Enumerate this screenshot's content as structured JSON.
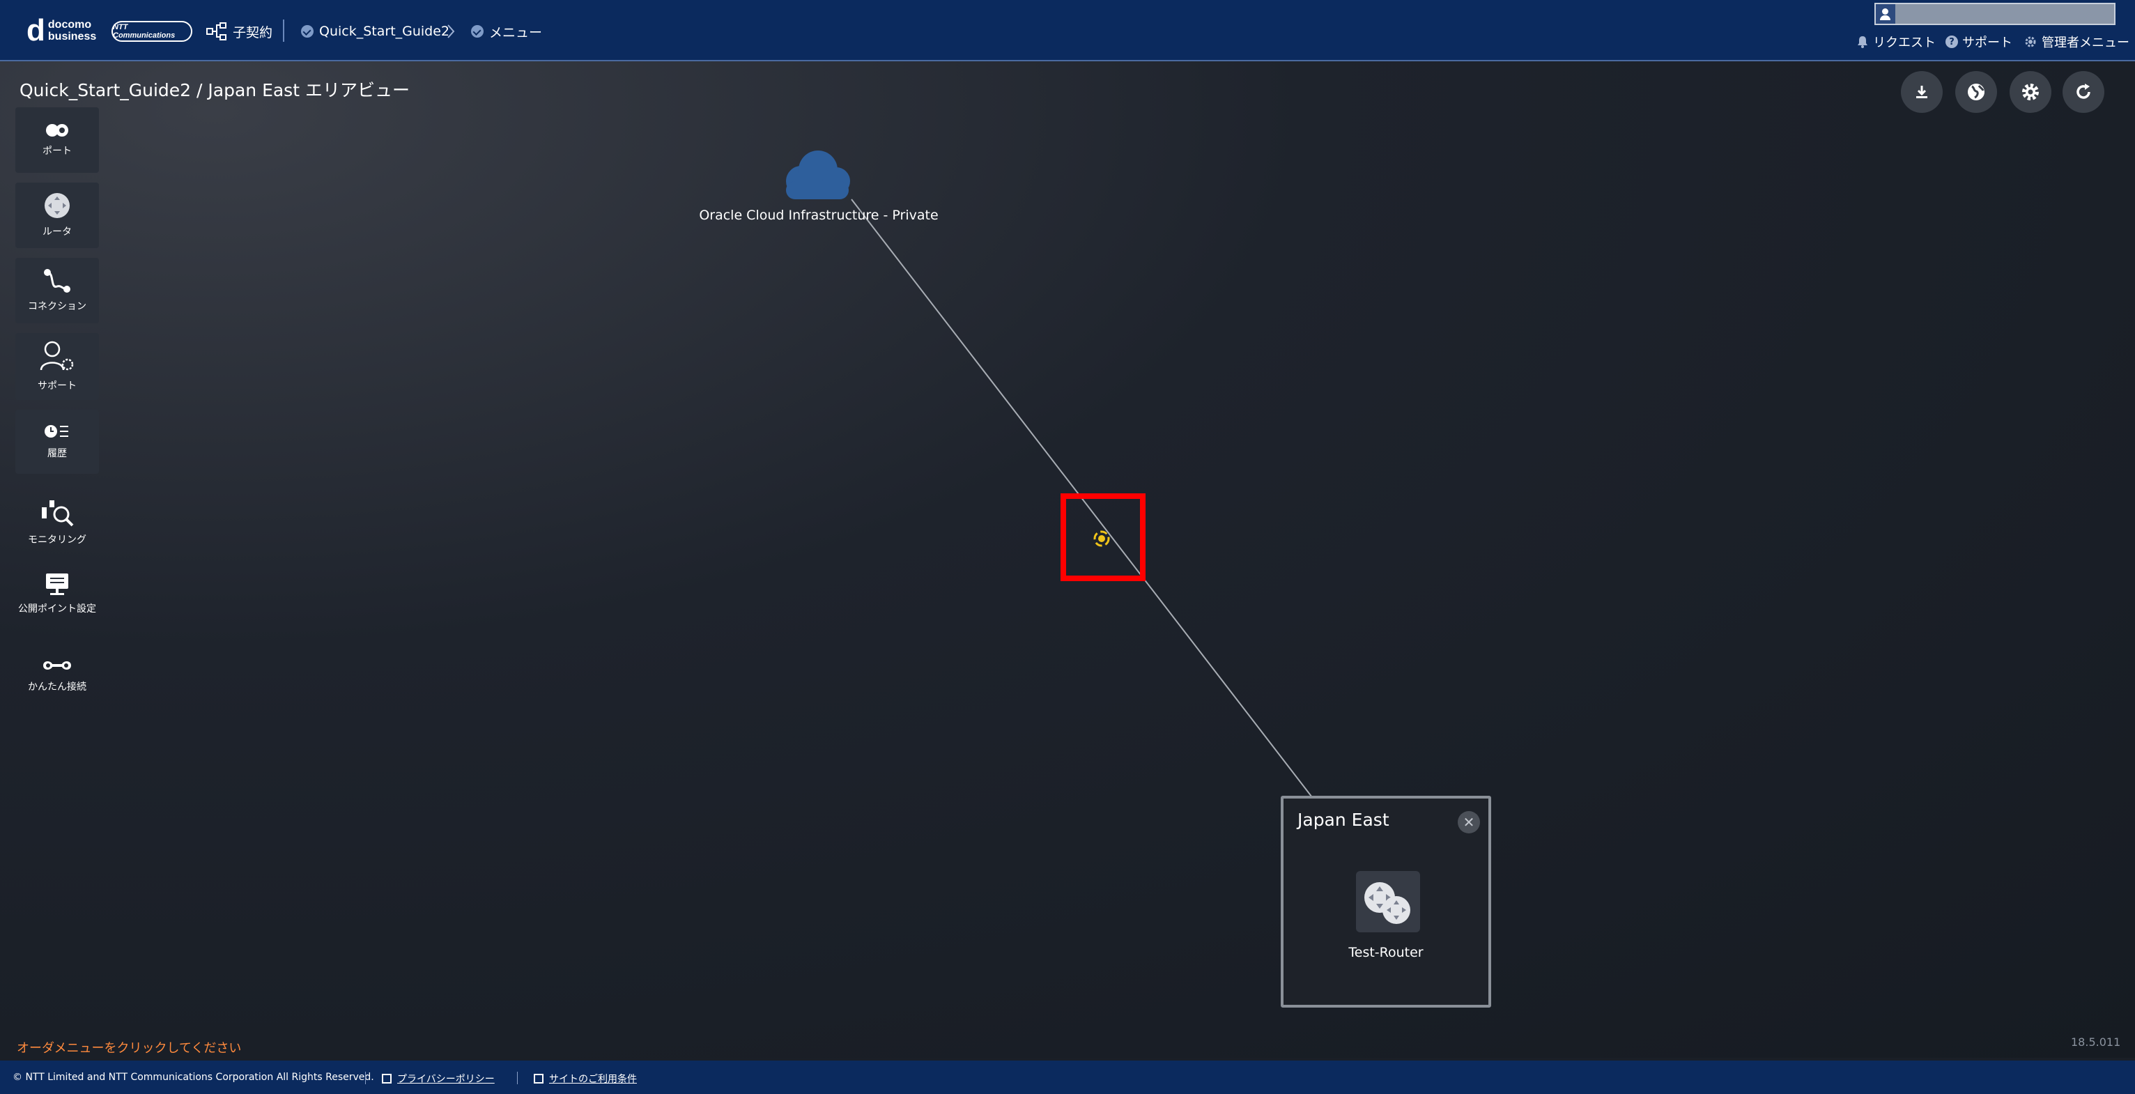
{
  "header": {
    "logo_line1": "docomo",
    "logo_line2": "business",
    "ntt_logo": "NTT Communications",
    "contract_label": "子契約",
    "breadcrumb_tenant": "Quick_Start_Guide2",
    "breadcrumb_menu": "メニュー",
    "request_label": "リクエスト",
    "support_label": "サポート",
    "admin_menu_label": "管理者メニュー",
    "user_name": ""
  },
  "page": {
    "title": "Quick_Start_Guide2 / Japan East エリアビュー"
  },
  "toolbar": {
    "items": [
      {
        "label": "ポート",
        "icon": "port-icon"
      },
      {
        "label": "ルータ",
        "icon": "router-icon"
      },
      {
        "label": "コネクション",
        "icon": "connection-icon"
      },
      {
        "label": "サポート",
        "icon": "support-icon"
      },
      {
        "label": "履歴",
        "icon": "history-icon"
      },
      {
        "label": "モニタリング",
        "icon": "monitoring-icon"
      },
      {
        "label": "公開ポイント設定",
        "icon": "public-point-icon"
      },
      {
        "label": "かんたん接続",
        "icon": "easy-connect-icon"
      }
    ]
  },
  "actions": {
    "buttons": [
      "download-icon",
      "globe-icon",
      "gear-icon",
      "refresh-icon"
    ]
  },
  "canvas": {
    "cloud_label": "Oracle Cloud Infrastructure - Private",
    "region_title": "Japan East",
    "router_label": "Test-Router",
    "close_symbol": "✕"
  },
  "status": {
    "order_message": "オーダメニューをクリックしてください",
    "version": "18.5.011"
  },
  "footer": {
    "copyright": "© NTT Limited and NTT Communications Corporation All Rights Reserved.",
    "privacy_link": "プライバシーポリシー",
    "terms_link": "サイトのご利用条件"
  },
  "colors": {
    "header_bg": "#0b2a5e",
    "canvas_bg": "#1a1f27",
    "highlight": "#ff0000",
    "connection_node": "#f0c419",
    "cloud": "#2e5f9c",
    "order_message": "#ff8a3d"
  }
}
